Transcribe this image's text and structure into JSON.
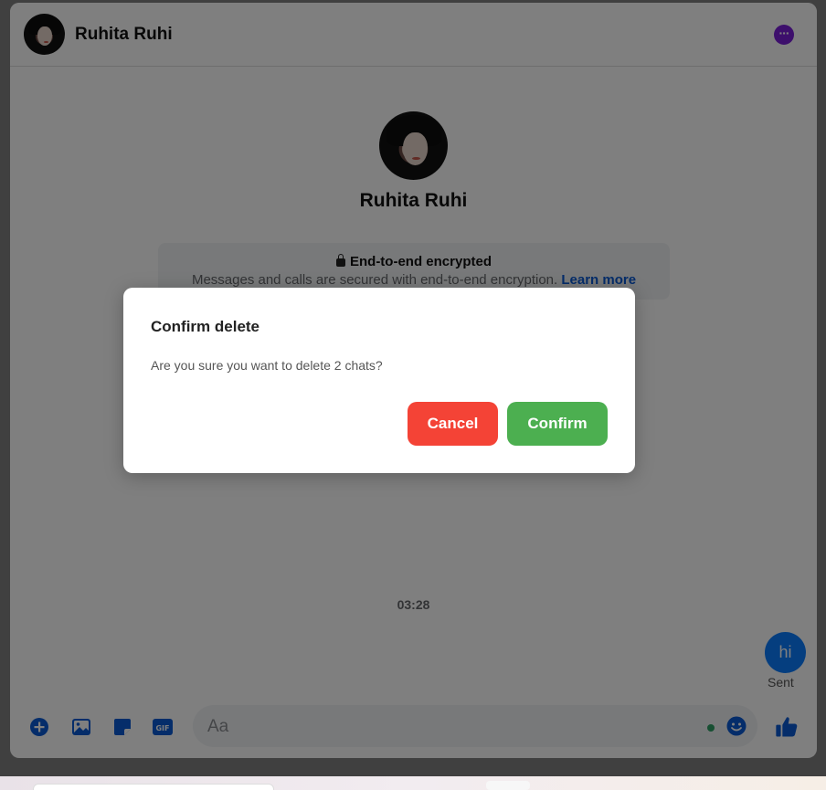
{
  "header": {
    "contact_name": "Ruhita Ruhi"
  },
  "profile": {
    "name": "Ruhita Ruhi"
  },
  "encryption": {
    "title": "End-to-end encrypted",
    "text": "Messages and calls are secured with end-to-end encryption.",
    "link": "Learn more"
  },
  "messages": {
    "timestamp": "03:28",
    "sent_text": "hi",
    "status": "Sent"
  },
  "composer": {
    "placeholder": "Aa",
    "icons": [
      "plus-circle-icon",
      "image-icon",
      "sticker-icon",
      "gif-icon",
      "emoji-icon",
      "thumbs-up-icon"
    ]
  },
  "dialog": {
    "title": "Confirm delete",
    "message": "Are you sure you want to delete 2 chats?",
    "cancel_label": "Cancel",
    "confirm_label": "Confirm"
  },
  "colors": {
    "accent": "#0a7cff",
    "cancel": "#f44336",
    "confirm": "#4caf50",
    "more_button": "#7b1fd8"
  }
}
